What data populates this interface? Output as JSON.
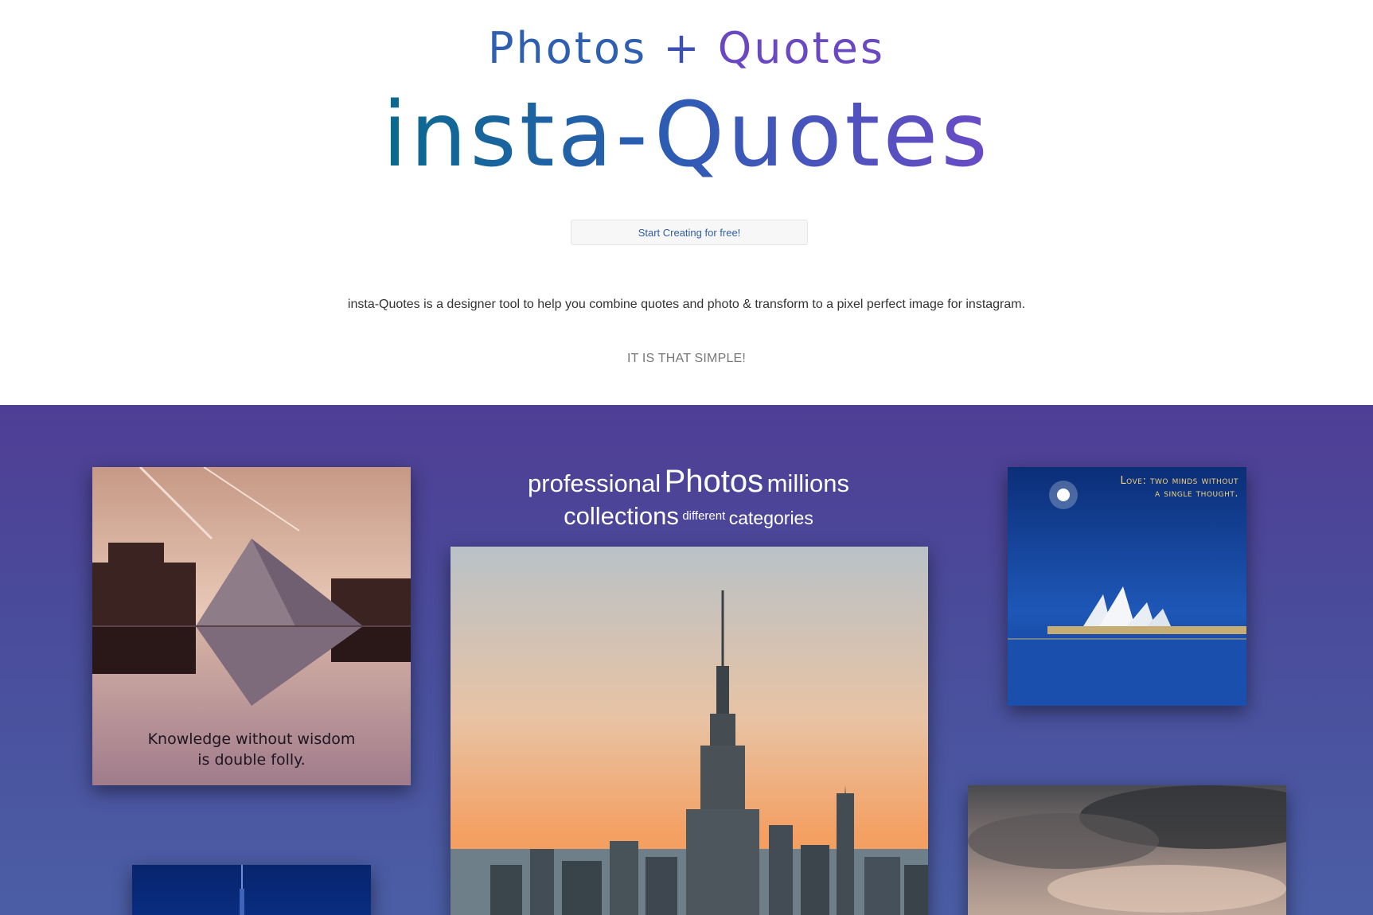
{
  "hero": {
    "subtitle_words": [
      "Photos",
      "+",
      "Quotes"
    ],
    "title": "insta-Quotes",
    "cta_label": "Start Creating for free!",
    "description": "insta-Quotes is a designer tool to help you combine quotes and photo & transform to a pixel perfect image for instagram.",
    "tagline": "IT IS THAT SIMPLE!"
  },
  "showcase": {
    "word_cloud": {
      "professional": "professional",
      "photos": "Photos",
      "millions": "millions",
      "collections": "collections",
      "different": "different",
      "categories": "categories"
    },
    "quotes": {
      "louvre": [
        "Knowledge without wisdom",
        "is double folly."
      ],
      "opera": [
        "Love: two minds without",
        "a single thought."
      ]
    }
  },
  "colors": {
    "title_gradient": [
      "#0a6a8f",
      "#2e5cb4",
      "#6a4bc6"
    ],
    "showcase_bg": [
      "#4f3e95",
      "#4b5ea5"
    ]
  }
}
